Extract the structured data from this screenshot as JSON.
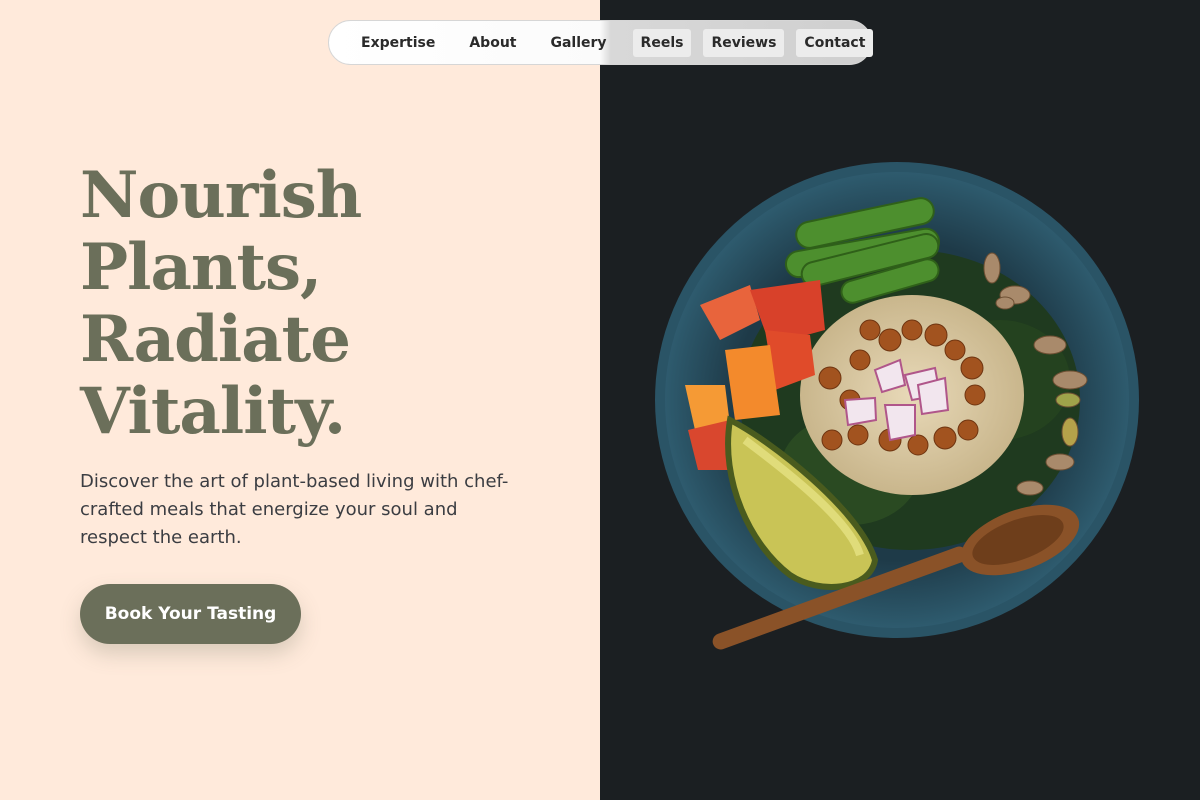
{
  "nav": {
    "items": [
      {
        "label": "Expertise"
      },
      {
        "label": "About"
      },
      {
        "label": "Gallery"
      },
      {
        "label": "Reels"
      },
      {
        "label": "Reviews"
      },
      {
        "label": "Contact"
      }
    ]
  },
  "hero": {
    "title_lines": [
      "Nourish",
      "Plants,",
      "Radiate",
      "Vitality."
    ],
    "description": "Discover the art of plant-based living with chef-crafted meals that energize your soul and respect the earth.",
    "cta_label": "Book Your Tasting"
  },
  "colors": {
    "background": "#ffeadb",
    "accent": "#6b6f5a",
    "text_body": "#3b3d42",
    "photo_background": "#1b1f22"
  }
}
